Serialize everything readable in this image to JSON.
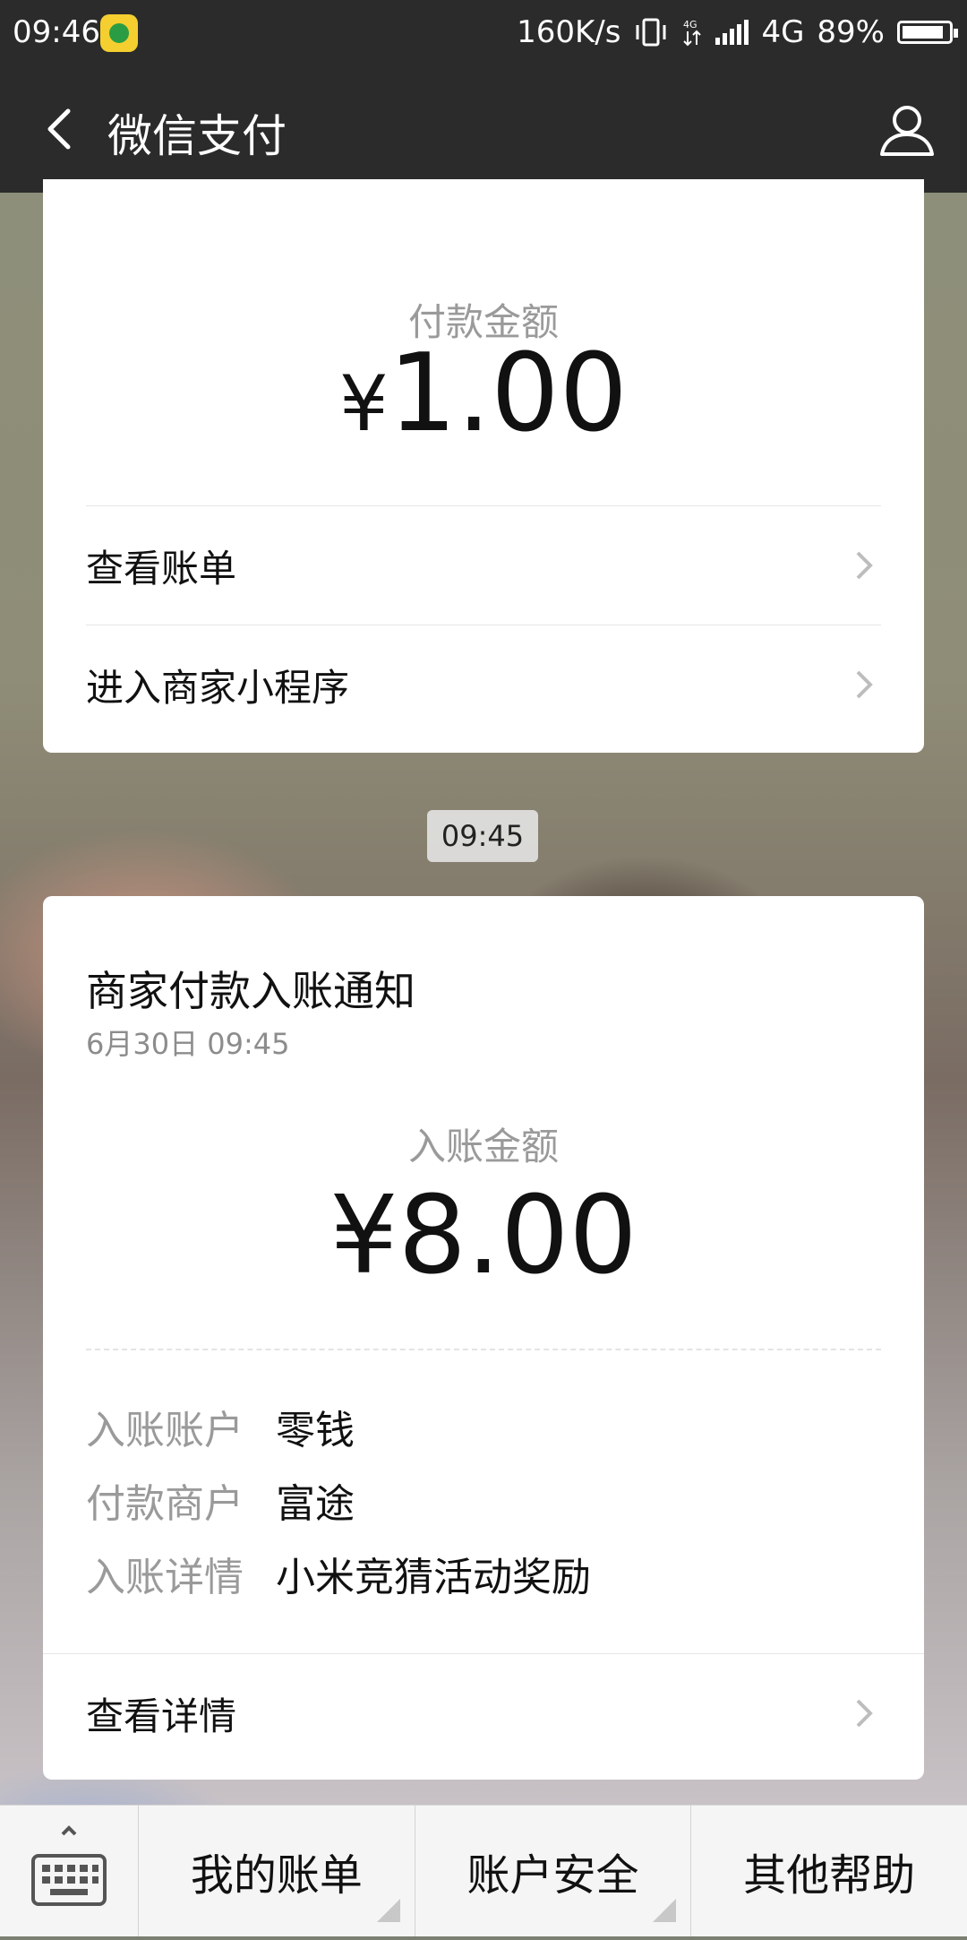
{
  "status_bar": {
    "time": "09:46",
    "net_speed": "160K/s",
    "network": "4G",
    "battery": "89%",
    "battery_level": 0.89
  },
  "nav": {
    "title": "微信支付"
  },
  "payment_card": {
    "amount_label": "付款金额",
    "currency": "¥",
    "amount": "1.00",
    "rows": [
      {
        "label": "查看账单"
      },
      {
        "label": "进入商家小程序"
      }
    ]
  },
  "time_chip": "09:45",
  "notice_card": {
    "title": "商家付款入账通知",
    "date": "6月30日  09:45",
    "amount_label": "入账金额",
    "currency": "¥",
    "amount": "8.00",
    "details": [
      {
        "key": "入账账户",
        "value": "零钱"
      },
      {
        "key": "付款商户",
        "value": "富途"
      },
      {
        "key": "入账详情",
        "value": "小米竞猜活动奖励"
      }
    ],
    "link": "查看详情"
  },
  "bottom_menu": {
    "items": [
      {
        "label": "我的账单"
      },
      {
        "label": "账户安全"
      },
      {
        "label": "其他帮助"
      }
    ]
  }
}
